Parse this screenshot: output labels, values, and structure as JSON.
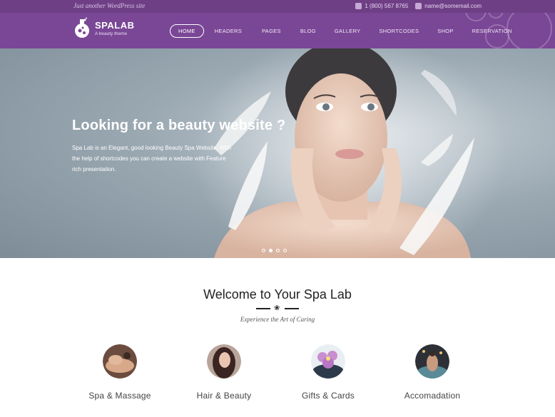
{
  "topbar": {
    "tagline": "Just another WordPress site",
    "phone": "1 (800) 567 8765",
    "email": "name@somemail.com",
    "phone_icon": "phone-icon",
    "email_icon": "mail-icon"
  },
  "header": {
    "logo_name": "SPALAB",
    "logo_sub": "A beauty theme",
    "logo_icon": "flask-icon",
    "nav": [
      {
        "label": "HOME",
        "active": true
      },
      {
        "label": "HEADERS"
      },
      {
        "label": "PAGES"
      },
      {
        "label": "BLOG"
      },
      {
        "label": "GALLERY"
      },
      {
        "label": "SHORTCODES"
      },
      {
        "label": "SHOP"
      },
      {
        "label": "RESERVATION"
      }
    ]
  },
  "hero": {
    "title": "Looking for a beauty website ?",
    "description": "Spa Lab is an Elegant, good looking Beauty Spa Website. With the help of shortcodes you can create a website with Feature rich presentation.",
    "slide_count": 4,
    "active_slide": 1
  },
  "welcome": {
    "title": "Welcome to Your Spa Lab",
    "subtitle": "Experience the Art of Caring"
  },
  "services": [
    {
      "label": "Spa & Massage",
      "icon": "massage-photo"
    },
    {
      "label": "Hair & Beauty",
      "icon": "hair-photo"
    },
    {
      "label": "Gifts & Cards",
      "icon": "flower-photo"
    },
    {
      "label": "Accomadation",
      "icon": "pool-photo"
    }
  ],
  "colors": {
    "topbar": "#6f3f86",
    "header": "#7a4796",
    "text_dark": "#222222"
  }
}
